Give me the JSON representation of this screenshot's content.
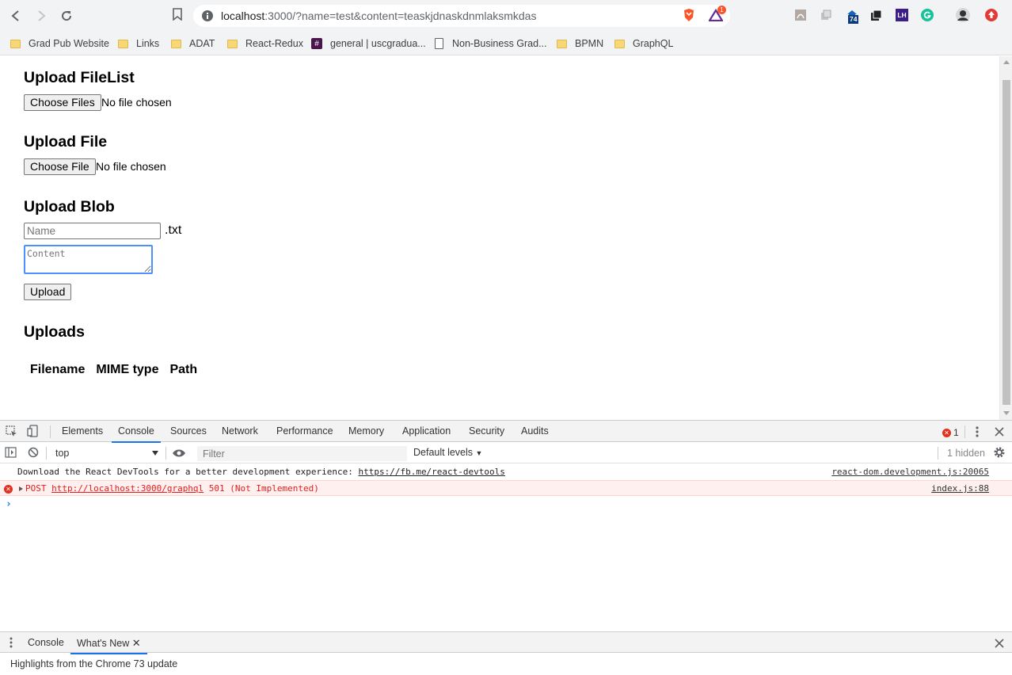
{
  "browser": {
    "url_host": "localhost",
    "url_rest": ":3000/?name=test&content=teaskjdnaskdnmlaksmkdas",
    "extension_badges": {
      "brave_rewards_count": "1",
      "tab_counter": "74",
      "lighthouse": "LH"
    },
    "bookmarks": [
      {
        "label": "Grad Pub Website",
        "type": "folder"
      },
      {
        "label": "Links",
        "type": "folder"
      },
      {
        "label": "ADAT",
        "type": "folder"
      },
      {
        "label": "React-Redux",
        "type": "folder"
      },
      {
        "label": "general | uscgradua...",
        "type": "slack"
      },
      {
        "label": "Non-Business Grad...",
        "type": "page"
      },
      {
        "label": "BPMN",
        "type": "folder"
      },
      {
        "label": "GraphQL",
        "type": "folder"
      }
    ]
  },
  "page": {
    "filelist_heading": "Upload FileList",
    "filelist_button": "Choose Files",
    "filelist_status": "No file chosen",
    "file_heading": "Upload File",
    "file_button": "Choose File",
    "file_status": "No file chosen",
    "blob_heading": "Upload Blob",
    "name_placeholder": "Name",
    "txt_suffix": ".txt",
    "content_placeholder": "Content",
    "upload_button": "Upload",
    "uploads_heading": "Uploads",
    "table_headers": [
      "Filename",
      "MIME type",
      "Path"
    ]
  },
  "devtools": {
    "tabs": [
      "Elements",
      "Console",
      "Sources",
      "Network",
      "Performance",
      "Memory",
      "Application",
      "Security",
      "Audits"
    ],
    "active_tab": "Console",
    "error_count": "1",
    "context": "top",
    "filter_placeholder": "Filter",
    "levels": "Default levels",
    "hidden": "1 hidden",
    "messages": [
      {
        "text_prefix": "Download the React DevTools for a better development experience: ",
        "link": "https://fb.me/react-devtools",
        "source": "react-dom.development.js:20065"
      },
      {
        "method": "POST ",
        "link": "http://localhost:3000/graphql",
        "text_suffix": " 501 (Not Implemented)",
        "source": "index.js:88"
      }
    ],
    "drawer_tabs": [
      "Console",
      "What's New"
    ],
    "drawer_text": "Highlights from the Chrome 73 update"
  },
  "colors": {
    "accent": "#1a73e8",
    "error": "#e02020",
    "error_bg": "#fff0f0",
    "chrome_bg": "#f1f3f4"
  }
}
